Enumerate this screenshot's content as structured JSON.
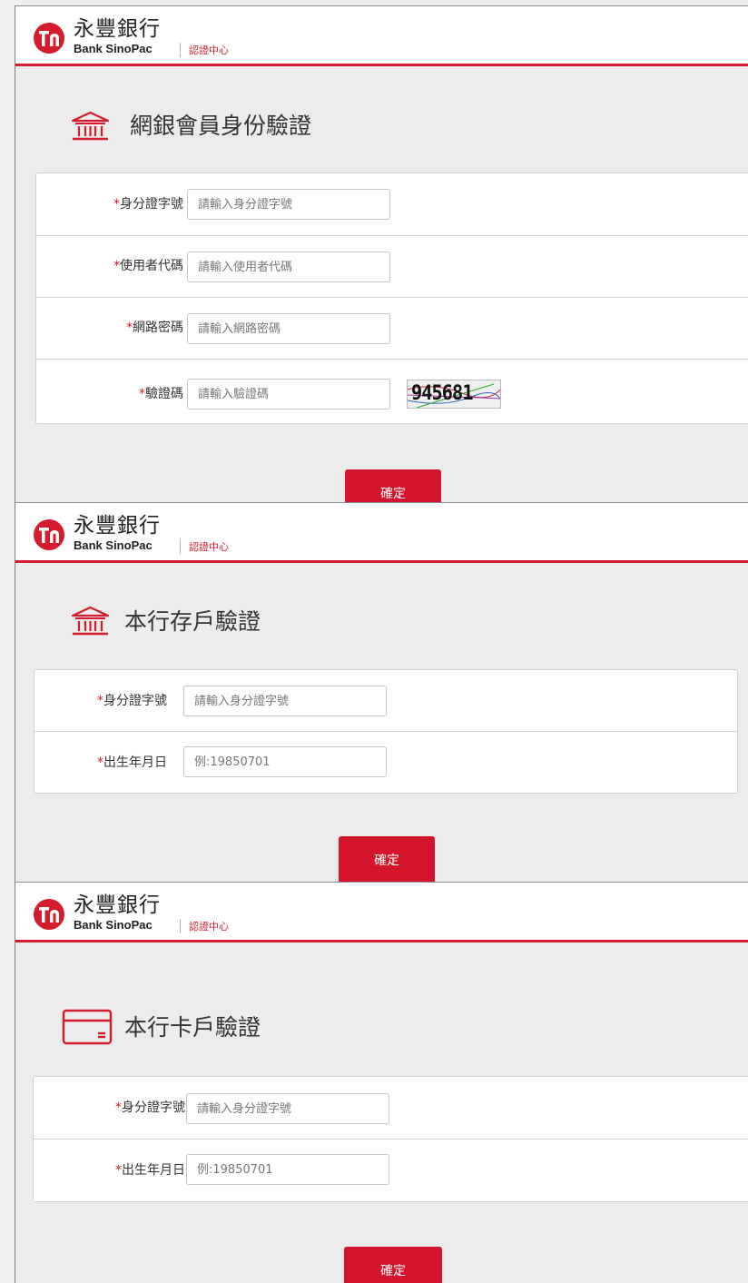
{
  "brand": {
    "name_cn": "永豐銀行",
    "name_en": "Bank SinoPac",
    "tagline": "認證中心",
    "accent_color": "#d41c2c"
  },
  "panels": [
    {
      "title": "網銀會員身份驗證",
      "icon": "bank-building-icon",
      "fields": [
        {
          "label": "身分證字號",
          "required_mark": "*",
          "placeholder": "請輸入身分證字號"
        },
        {
          "label": "使用者代碼",
          "required_mark": "*",
          "placeholder": "請輸入使用者代碼"
        },
        {
          "label": "網路密碼",
          "required_mark": "*",
          "placeholder": "請輸入網路密碼"
        },
        {
          "label": "驗證碼",
          "required_mark": "*",
          "placeholder": "請輸入驗證碼"
        }
      ],
      "captcha_text": "945681",
      "confirm_label": "確定"
    },
    {
      "title": "本行存戶驗證",
      "icon": "bank-building-icon",
      "fields": [
        {
          "label": "身分證字號",
          "required_mark": "*",
          "placeholder": "請輸入身分證字號"
        },
        {
          "label": "出生年月日",
          "required_mark": "*",
          "placeholder": "例:19850701"
        }
      ],
      "confirm_label": "確定"
    },
    {
      "title": "本行卡戶驗證",
      "icon": "credit-card-icon",
      "fields": [
        {
          "label": "身分證字號",
          "required_mark": "*",
          "placeholder": "請輸入身分證字號"
        },
        {
          "label": "出生年月日",
          "required_mark": "*",
          "placeholder": "例:19850701"
        }
      ],
      "confirm_label": "確定"
    }
  ]
}
